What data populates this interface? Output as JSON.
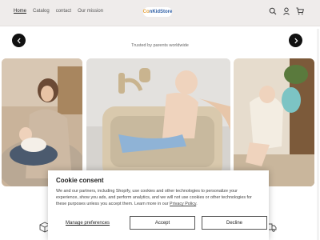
{
  "header": {
    "nav": [
      "Home",
      "Catalog",
      "contact",
      "Our mission"
    ],
    "logo_parts": [
      "Co",
      "nKidStore"
    ]
  },
  "hero": {
    "tagline": "Trusted by parents worldwide"
  },
  "cookie": {
    "title": "Cookie consent",
    "body": "We and our partners, including Shopify, use cookies and other technologies to personalize your experience, show you ads, and perform analytics, and we will not use cookies or other technologies for these purposes unless you accept them. Learn more in our ",
    "policy_link": "Privacy Policy",
    "policy_suffix": ".",
    "manage": "Manage preferences",
    "accept": "Accept",
    "decline": "Decline"
  },
  "colors": {
    "header_bg": "#efeceb",
    "logo_blue": "#2f5fa6",
    "logo_orange": "#e6a23c"
  },
  "icons": [
    "search-icon",
    "account-icon",
    "cart-icon",
    "chevron-left-icon",
    "chevron-right-icon"
  ]
}
